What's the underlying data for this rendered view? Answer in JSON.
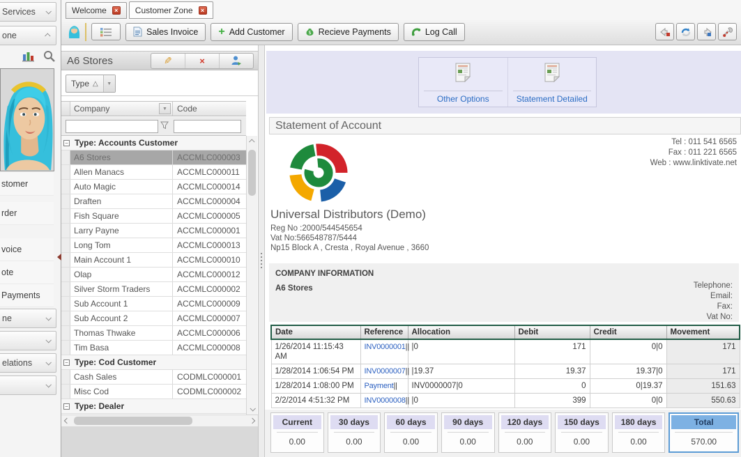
{
  "icons": {
    "close": "×",
    "sort_asc": "△",
    "dropdown": "▼",
    "plus": "+",
    "collapse": "−"
  },
  "sidebar": {
    "section_services": "Services",
    "section_zone": "one",
    "menu_items": [
      "stomer",
      "rder",
      "voice",
      "ote",
      "Payments"
    ],
    "accordions": [
      "ne",
      "",
      "elations",
      ""
    ]
  },
  "tabs": {
    "welcome": "Welcome",
    "customer_zone": "Customer Zone"
  },
  "toolbar": {
    "sales_invoice": "Sales Invoice",
    "add_customer": "Add Customer",
    "receive_payments": "Recieve Payments",
    "log_call": "Log Call"
  },
  "customer_panel": {
    "title": "A6 Stores",
    "group_by": "Type",
    "columns": {
      "company": "Company",
      "code": "Code"
    },
    "groups": [
      {
        "label": "Type: Accounts Customer",
        "rows": [
          {
            "company": "A6 Stores",
            "code": "ACCMLC000003"
          },
          {
            "company": "Allen Manacs",
            "code": "ACCMLC000011"
          },
          {
            "company": "Auto Magic",
            "code": "ACCMLC000014"
          },
          {
            "company": "Draften",
            "code": "ACCMLC000004"
          },
          {
            "company": "Fish Square",
            "code": "ACCMLC000005"
          },
          {
            "company": "Larry Payne",
            "code": "ACCMLC000001"
          },
          {
            "company": "Long Tom",
            "code": "ACCMLC000013"
          },
          {
            "company": "Main Account 1",
            "code": "ACCMLC000010"
          },
          {
            "company": "Olap",
            "code": "ACCMLC000012"
          },
          {
            "company": "Silver Storm Traders",
            "code": "ACCMLC000002"
          },
          {
            "company": "Sub Account 1",
            "code": "ACCMLC000009"
          },
          {
            "company": "Sub Account 2",
            "code": "ACCMLC000007"
          },
          {
            "company": "Thomas Thwake",
            "code": "ACCMLC000006"
          },
          {
            "company": "Tim Basa",
            "code": "ACCMLC000008"
          }
        ]
      },
      {
        "label": "Type: Cod Customer",
        "rows": [
          {
            "company": "Cash Sales",
            "code": "CODMLC000001"
          },
          {
            "company": "Misc Cod",
            "code": "CODMLC000002"
          }
        ]
      },
      {
        "label": "Type: Dealer",
        "rows": []
      }
    ]
  },
  "ribbon": {
    "other_options": "Other Options",
    "statement_detailed": "Statement Detailed"
  },
  "statement": {
    "title": "Statement of Account",
    "contact": {
      "tel": "Tel : 011 541 6565",
      "fax": "Fax : 011 221 6565",
      "web": "Web : www.linktivate.net"
    },
    "company": {
      "name": "Universal Distributors (Demo)",
      "reg_no": "Reg No :2000/544545654",
      "vat_no": "Vat No:566548787/5444",
      "address": "Np15 Block A , Cresta , Royal Avenue , 3660"
    },
    "info_panel": {
      "heading": "COMPANY INFORMATION",
      "customer": "A6 Stores",
      "labels": [
        "Telephone:",
        "Email:",
        "Fax:",
        "Vat No:"
      ]
    },
    "table": {
      "headers": [
        "Date",
        "Reference",
        "Allocation",
        "Debit",
        "Credit",
        "Movement"
      ],
      "rows": [
        {
          "date": "1/26/2014 11:15:43 AM",
          "reference": "INV0000001",
          "ref_suffix": "||",
          "allocation": "|0",
          "debit": "171",
          "credit": "0|0",
          "movement": "171"
        },
        {
          "date": "1/28/2014 1:06:54 PM",
          "reference": "INV0000007",
          "ref_suffix": "||",
          "allocation": "|19.37",
          "debit": "19.37",
          "credit": "19.37|0",
          "movement": "171"
        },
        {
          "date": "1/28/2014 1:08:00 PM",
          "reference": "Payment",
          "ref_suffix": "||",
          "allocation": "INV0000007|0",
          "debit": "0",
          "credit": "0|19.37",
          "movement": "151.63"
        },
        {
          "date": "2/2/2014 4:51:32 PM",
          "reference": "INV0000008",
          "ref_suffix": "||",
          "allocation": "|0",
          "debit": "399",
          "credit": "0|0",
          "movement": "550.63"
        }
      ]
    },
    "aging": [
      {
        "label": "Current",
        "value": "0.00"
      },
      {
        "label": "30 days",
        "value": "0.00"
      },
      {
        "label": "60 days",
        "value": "0.00"
      },
      {
        "label": "90 days",
        "value": "0.00"
      },
      {
        "label": "120 days",
        "value": "0.00"
      },
      {
        "label": "150 days",
        "value": "0.00"
      },
      {
        "label": "180 days",
        "value": "0.00"
      },
      {
        "label": "Total",
        "value": "570.00"
      }
    ]
  },
  "colors": {
    "accent_lavender": "#e4e4f4",
    "link_blue": "#2a5fc0",
    "table_header_border_green": "#215c46",
    "selection_gray": "#a7a7a7",
    "tab_close_red": "#b93a22",
    "total_highlight_blue": "#7db1e3"
  }
}
